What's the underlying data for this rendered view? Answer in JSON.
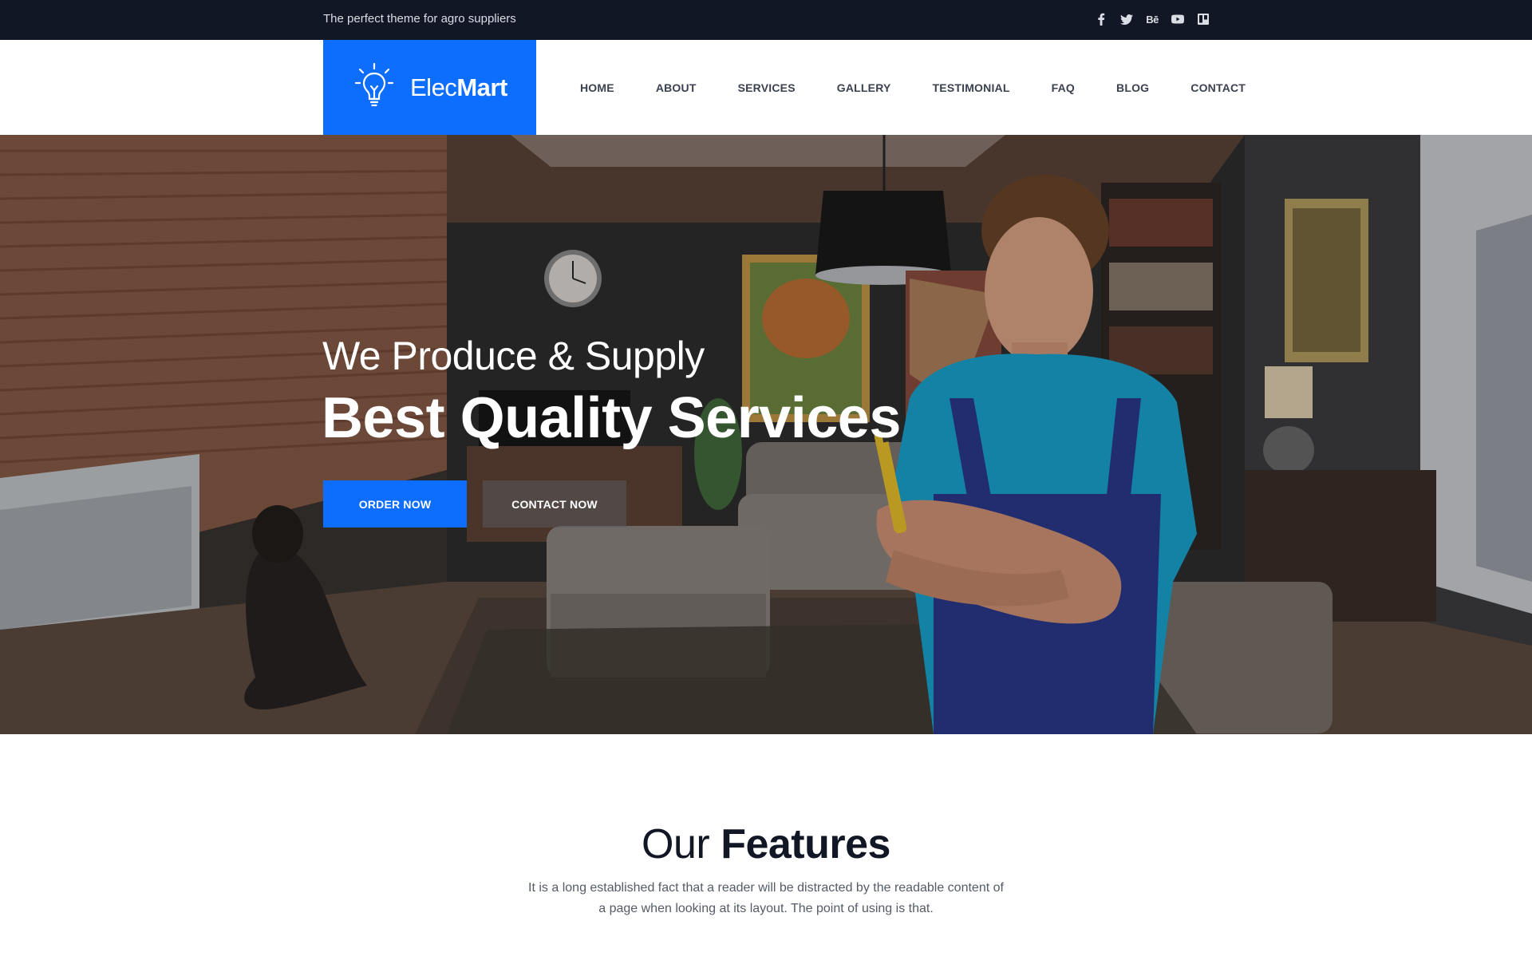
{
  "topbar": {
    "tagline": "The perfect theme for agro suppliers",
    "socials": [
      {
        "icon": "facebook-icon"
      },
      {
        "icon": "twitter-icon"
      },
      {
        "icon": "behance-icon",
        "text": "Bē"
      },
      {
        "icon": "youtube-icon"
      },
      {
        "icon": "trello-icon"
      }
    ]
  },
  "header": {
    "logo": {
      "light": "Elec",
      "bold": "Mart",
      "icon": "lightbulb-icon"
    },
    "nav": [
      "HOME",
      "ABOUT",
      "SERVICES",
      "GALLERY",
      "TESTIMONIAL",
      "FAQ",
      "BLOG",
      "CONTACT"
    ]
  },
  "hero": {
    "subtitle": "We Produce & Supply",
    "title": "Best Quality Services",
    "order_button": "ORDER NOW",
    "contact_button": "CONTACT NOW"
  },
  "features": {
    "title_light": "Our",
    "title_bold": "Features",
    "description": "It is a long established fact that a reader will be distracted by the readable content of a page when looking at its layout. The point of using is that."
  },
  "colors": {
    "accent": "#0d6efd",
    "topbar": "#111724"
  }
}
